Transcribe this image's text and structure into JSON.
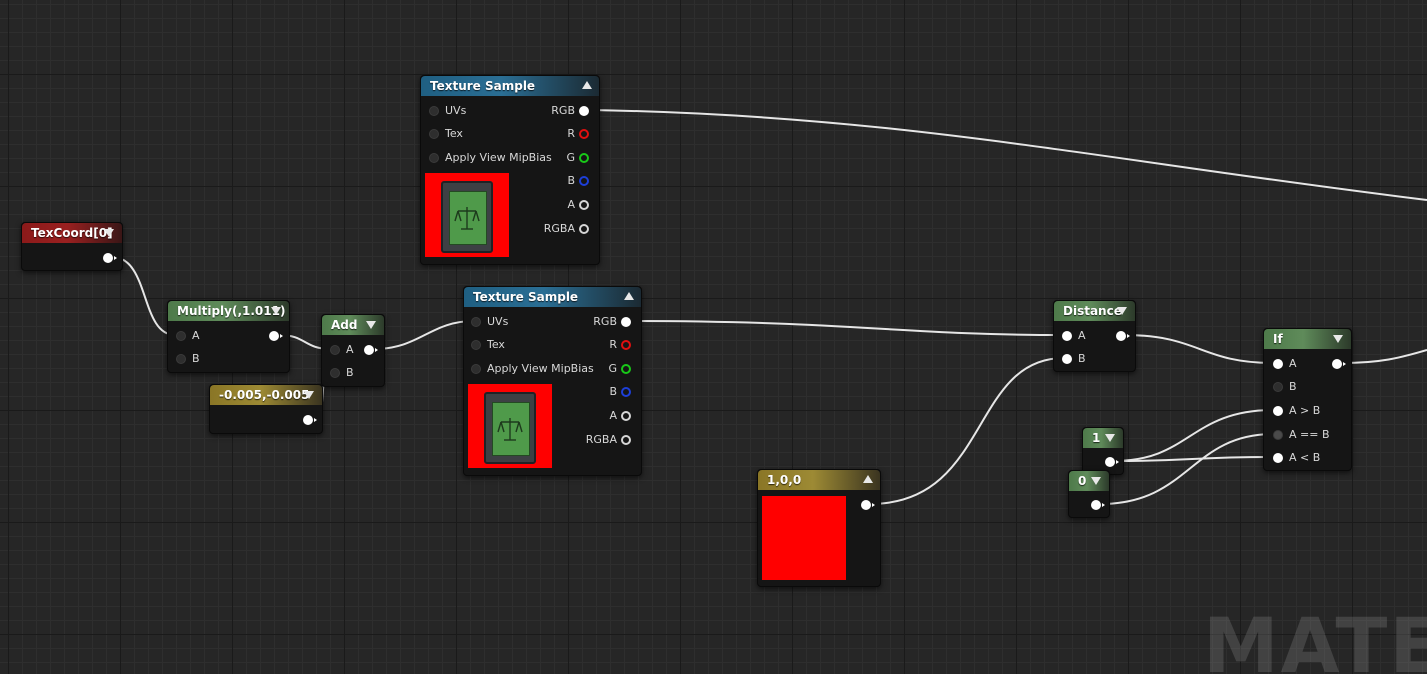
{
  "graph": {
    "watermark": "MATER"
  },
  "nodes": {
    "texture_sample_1": {
      "title": "Texture Sample",
      "inputs": [
        "UVs",
        "Tex",
        "Apply View MipBias"
      ],
      "outputs": [
        "RGB",
        "R",
        "G",
        "B",
        "A",
        "RGBA"
      ]
    },
    "texture_sample_2": {
      "title": "Texture Sample",
      "inputs": [
        "UVs",
        "Tex",
        "Apply View MipBias"
      ],
      "outputs": [
        "RGB",
        "R",
        "G",
        "B",
        "A",
        "RGBA"
      ]
    },
    "texcoord": {
      "title": "TexCoord[0]"
    },
    "multiply": {
      "title": "Multiply(,1.011)",
      "inputs": [
        "A",
        "B"
      ]
    },
    "add": {
      "title": "Add",
      "inputs": [
        "A",
        "B"
      ]
    },
    "constant2": {
      "title": "-0.005,-0.005"
    },
    "constant3": {
      "title": "1,0,0",
      "swatch_color": "#ff0000"
    },
    "distance": {
      "title": "Distance",
      "inputs": [
        "A",
        "B"
      ]
    },
    "const_one": {
      "title": "1"
    },
    "const_zero": {
      "title": "0"
    },
    "if": {
      "title": "If",
      "inputs": [
        "A",
        "B",
        "A > B",
        "A == B",
        "A < B"
      ]
    }
  },
  "colors": {
    "header_texture": "#2a6e94",
    "header_texcoord": "#9a2020",
    "header_math": "#5f8b5a",
    "header_constant": "#9d8a34",
    "pin_r": "#e01010",
    "pin_g": "#18c818",
    "pin_b": "#1d3fd8",
    "wire": "#ffffff",
    "preview_background": "#ff0000"
  }
}
